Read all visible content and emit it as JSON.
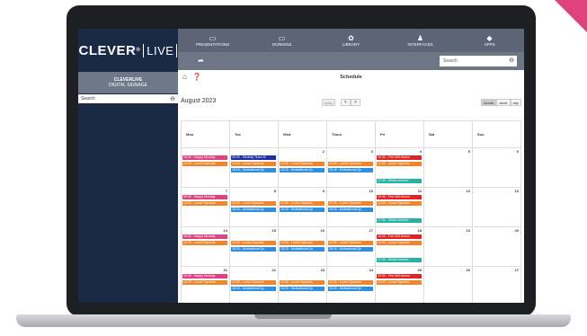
{
  "logo": {
    "main": "CLEVER",
    "reg": "®",
    "live": "LIVE"
  },
  "brand": {
    "name": "CLEVERLIVE",
    "sub": "DIGITAL SIGNAGE"
  },
  "sidebar": {
    "search_placeholder": "Search"
  },
  "nav": {
    "items": [
      {
        "label": "PRESENTATIONS",
        "icon": "presentations-icon",
        "glyph": "▭"
      },
      {
        "label": "SCREENS",
        "icon": "monitor-icon",
        "glyph": "▭"
      },
      {
        "label": "LIBRARY",
        "icon": "library-icon",
        "glyph": "✿"
      },
      {
        "label": "INTERFACES",
        "icon": "interfaces-icon",
        "glyph": "♟"
      },
      {
        "label": "APPS",
        "icon": "android-icon",
        "glyph": "◆"
      }
    ],
    "search_placeholder": "Search"
  },
  "page": {
    "title": "Schedule"
  },
  "calendar": {
    "month": "August 2023",
    "today_label": "today",
    "prev": "<",
    "next": ">",
    "views": [
      "month",
      "week",
      "day"
    ],
    "weekdays": [
      "Mon",
      "Tue",
      "Wed",
      "Thurs",
      "Fri",
      "Sat",
      "Sun"
    ],
    "weeks": [
      [
        "",
        "",
        "2",
        "3",
        "4",
        "5",
        "6"
      ],
      [
        "7",
        "8",
        "9",
        "10",
        "11",
        "12",
        "13"
      ],
      [
        "14",
        "15",
        "16",
        "17",
        "18",
        "19",
        "20"
      ],
      [
        "21",
        "22",
        "23",
        "24",
        "25",
        "26",
        "27"
      ]
    ],
    "events": [
      {
        "week": 0,
        "day": 0,
        "slot": 0,
        "text": "09:00 - Happy Monday",
        "color": "#e0417f"
      },
      {
        "week": 0,
        "day": 1,
        "slot": 0,
        "text": "09:00 - Monthly Team M",
        "color": "#1e2ea8"
      },
      {
        "week": 0,
        "day": 4,
        "slot": 0,
        "text": "10:30 - Fire Drill Annou",
        "color": "#e02424"
      },
      {
        "week": 0,
        "day": 0,
        "slot": 1,
        "text": "12:00 - Lunch Specials",
        "color": "#f2842a"
      },
      {
        "week": 0,
        "day": 1,
        "slot": 1,
        "text": "12:00 - Lunch Specials",
        "color": "#f2842a"
      },
      {
        "week": 0,
        "day": 2,
        "slot": 1,
        "text": "12:00 - Lunch Specials",
        "color": "#f2842a"
      },
      {
        "week": 0,
        "day": 3,
        "slot": 1,
        "text": "12:00 - Lunch Specials",
        "color": "#f2842a"
      },
      {
        "week": 0,
        "day": 4,
        "slot": 1,
        "text": "12:00 - Lunch Specials",
        "color": "#f2842a"
      },
      {
        "week": 0,
        "day": 1,
        "slot": 2,
        "text": "15:15 - Motivational Qu",
        "color": "#2d8fe0"
      },
      {
        "week": 0,
        "day": 2,
        "slot": 2,
        "text": "15:15 - Motivational Qu",
        "color": "#2d8fe0"
      },
      {
        "week": 0,
        "day": 3,
        "slot": 2,
        "text": "15:15 - Motivational Qu",
        "color": "#2d8fe0"
      },
      {
        "week": 0,
        "day": 4,
        "slot": 3,
        "text": "17:00 - Drinks Announ",
        "color": "#26b3a6"
      },
      {
        "week": 1,
        "day": 0,
        "slot": 0,
        "text": "09:00 - Happy Monday",
        "color": "#e0417f"
      },
      {
        "week": 1,
        "day": 4,
        "slot": 0,
        "text": "10:30 - Fire Drill Annou",
        "color": "#e02424"
      },
      {
        "week": 1,
        "day": 0,
        "slot": 1,
        "text": "12:00 - Lunch Specials",
        "color": "#f2842a"
      },
      {
        "week": 1,
        "day": 1,
        "slot": 1,
        "text": "12:00 - Lunch Specials",
        "color": "#f2842a"
      },
      {
        "week": 1,
        "day": 2,
        "slot": 1,
        "text": "12:00 - Lunch Specials",
        "color": "#f2842a"
      },
      {
        "week": 1,
        "day": 3,
        "slot": 1,
        "text": "12:00 - Lunch Specials",
        "color": "#f2842a"
      },
      {
        "week": 1,
        "day": 4,
        "slot": 1,
        "text": "12:00 - Lunch Specials",
        "color": "#f2842a"
      },
      {
        "week": 1,
        "day": 1,
        "slot": 2,
        "text": "15:15 - Motivational Qu",
        "color": "#2d8fe0"
      },
      {
        "week": 1,
        "day": 2,
        "slot": 2,
        "text": "15:15 - Motivational Qu",
        "color": "#2d8fe0"
      },
      {
        "week": 1,
        "day": 3,
        "slot": 2,
        "text": "15:15 - Motivational Qu",
        "color": "#2d8fe0"
      },
      {
        "week": 1,
        "day": 4,
        "slot": 3,
        "text": "17:00 - Drinks Announ",
        "color": "#26b3a6"
      },
      {
        "week": 2,
        "day": 0,
        "slot": 0,
        "text": "09:00 - Happy Monday",
        "color": "#e0417f"
      },
      {
        "week": 2,
        "day": 4,
        "slot": 0,
        "text": "10:30 - Fire Drill Annou",
        "color": "#e02424"
      },
      {
        "week": 2,
        "day": 0,
        "slot": 1,
        "text": "12:00 - Lunch Specials",
        "color": "#f2842a"
      },
      {
        "week": 2,
        "day": 1,
        "slot": 1,
        "text": "12:00 - Lunch Specials",
        "color": "#f2842a"
      },
      {
        "week": 2,
        "day": 2,
        "slot": 1,
        "text": "12:00 - Lunch Specials",
        "color": "#f2842a"
      },
      {
        "week": 2,
        "day": 3,
        "slot": 1,
        "text": "12:00 - Lunch Specials",
        "color": "#f2842a"
      },
      {
        "week": 2,
        "day": 4,
        "slot": 1,
        "text": "12:00 - Lunch Specials",
        "color": "#f2842a"
      },
      {
        "week": 2,
        "day": 1,
        "slot": 2,
        "text": "15:15 - Motivational Qu",
        "color": "#2d8fe0"
      },
      {
        "week": 2,
        "day": 2,
        "slot": 2,
        "text": "15:15 - Motivational Qu",
        "color": "#2d8fe0"
      },
      {
        "week": 2,
        "day": 3,
        "slot": 2,
        "text": "15:15 - Motivational Qu",
        "color": "#2d8fe0"
      },
      {
        "week": 2,
        "day": 4,
        "slot": 3,
        "text": "17:00 - Drinks Announ",
        "color": "#26b3a6"
      },
      {
        "week": 3,
        "day": 0,
        "slot": 0,
        "text": "09:00 - Happy Monday",
        "color": "#e0417f"
      },
      {
        "week": 3,
        "day": 4,
        "slot": 0,
        "text": "10:30 - Fire Drill Annou",
        "color": "#e02424"
      },
      {
        "week": 3,
        "day": 0,
        "slot": 1,
        "text": "12:00 - Lunch Specials",
        "color": "#f2842a"
      },
      {
        "week": 3,
        "day": 1,
        "slot": 1,
        "text": "12:00 - Lunch Specials",
        "color": "#f2842a"
      },
      {
        "week": 3,
        "day": 2,
        "slot": 1,
        "text": "12:00 - Lunch Specials",
        "color": "#f2842a"
      },
      {
        "week": 3,
        "day": 3,
        "slot": 1,
        "text": "12:00 - Lunch Specials",
        "color": "#f2842a"
      },
      {
        "week": 3,
        "day": 4,
        "slot": 1,
        "text": "12:00 - Lunch Specials",
        "color": "#f2842a"
      },
      {
        "week": 3,
        "day": 1,
        "slot": 2,
        "text": "15:15 - Motivational Qu",
        "color": "#2d8fe0"
      },
      {
        "week": 3,
        "day": 2,
        "slot": 2,
        "text": "15:15 - Motivational Qu",
        "color": "#2d8fe0"
      },
      {
        "week": 3,
        "day": 3,
        "slot": 2,
        "text": "15:15 - Motivational Qu",
        "color": "#2d8fe0"
      }
    ]
  }
}
